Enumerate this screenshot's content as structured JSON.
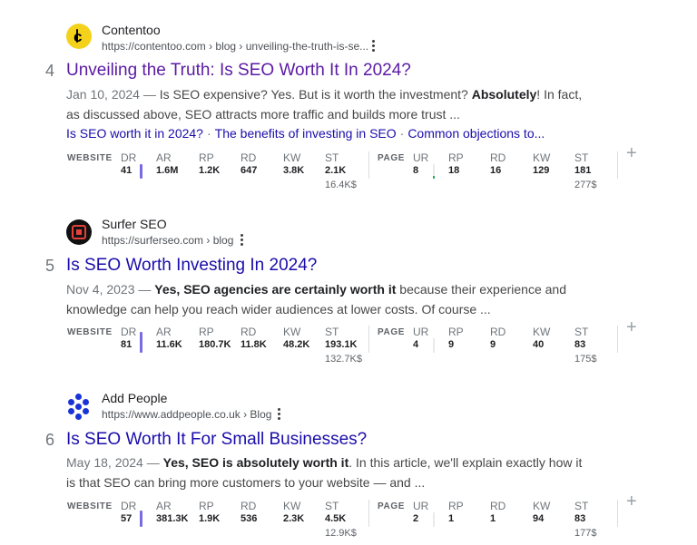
{
  "results": [
    {
      "site": "Contentoo",
      "url": "https://contentoo.com › blog › unveiling-the-truth-is-se...",
      "number": "4",
      "title": "Unveiling the Truth: Is SEO Worth It In 2024?",
      "snippet": {
        "date": "Jan 10, 2024 — ",
        "text1": "Is SEO expensive? Yes. But is it worth the investment? ",
        "bold": "Absolutely",
        "text2": "! In fact, as discussed above, SEO attracts more traffic and builds more trust ..."
      },
      "sitelinks": [
        "Is SEO worth it in 2024?",
        "The benefits of investing in SEO",
        "Common objections to..."
      ],
      "metrics": {
        "website": {
          "DR": "41",
          "AR": "1.6M",
          "RP": "1.2K",
          "RD": "647",
          "KW": "3.8K",
          "ST": "2.1K",
          "ST_value": "16.4K$"
        },
        "page": {
          "UR": "8",
          "RP": "18",
          "RD": "16",
          "KW": "129",
          "ST": "181",
          "ST_value": "277$"
        }
      }
    },
    {
      "site": "Surfer SEO",
      "url": "https://surferseo.com › blog",
      "number": "5",
      "title": "Is SEO Worth Investing In 2024?",
      "snippet": {
        "date": "Nov 4, 2023 — ",
        "text1": "",
        "bold": "Yes, SEO agencies are certainly worth it",
        "text2": " because their experience and knowledge can help you reach wider audiences at lower costs. Of course ..."
      },
      "metrics": {
        "website": {
          "DR": "81",
          "AR": "11.6K",
          "RP": "180.7K",
          "RD": "11.8K",
          "KW": "48.2K",
          "ST": "193.1K",
          "ST_value": "132.7K$"
        },
        "page": {
          "UR": "4",
          "RP": "9",
          "RD": "9",
          "KW": "40",
          "ST": "83",
          "ST_value": "175$"
        }
      }
    },
    {
      "site": "Add People",
      "url": "https://www.addpeople.co.uk › Blog",
      "number": "6",
      "title": "Is SEO Worth It For Small Businesses?",
      "snippet": {
        "date": "May 18, 2024 — ",
        "text1": "",
        "bold": "Yes, SEO is absolutely worth it",
        "text2": ". In this article, we'll explain exactly how it is that SEO can bring more customers to your website — and ..."
      },
      "metrics": {
        "website": {
          "DR": "57",
          "AR": "381.3K",
          "RP": "1.9K",
          "RD": "536",
          "KW": "2.3K",
          "ST": "4.5K",
          "ST_value": "12.9K$"
        },
        "page": {
          "UR": "2",
          "RP": "1",
          "RD": "1",
          "KW": "94",
          "ST": "83",
          "ST_value": "177$"
        }
      }
    }
  ],
  "labels": {
    "website": "WEBSITE",
    "page": "PAGE",
    "DR": "DR",
    "AR": "AR",
    "RP": "RP",
    "RD": "RD",
    "KW": "KW",
    "ST": "ST",
    "UR": "UR",
    "plus": "+"
  },
  "colors": {
    "visited_title": "#5a1aa4",
    "link_title": "#1a0dab",
    "dr_bar": "#7b6be0"
  }
}
